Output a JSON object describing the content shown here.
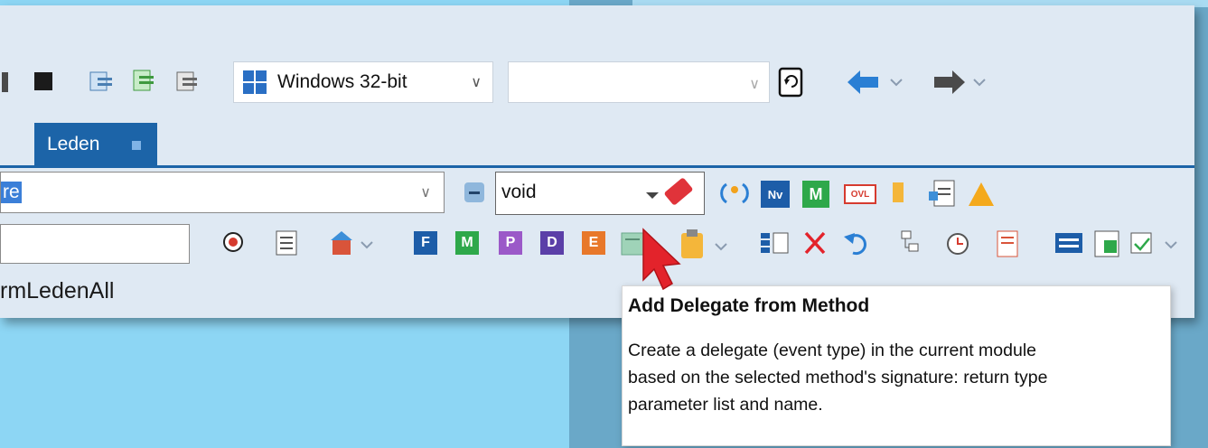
{
  "toolbar": {
    "platform": "Windows 32-bit",
    "second_select": ""
  },
  "tabs": [
    {
      "label": "Leden"
    }
  ],
  "member_bar": {
    "member_selected_text": "re",
    "return_type": "void",
    "badges": {
      "nv": "Nv",
      "m": "M",
      "ovl": "OVL"
    }
  },
  "member_toolbar": {
    "letter_buttons": [
      "F",
      "M",
      "P",
      "D",
      "E"
    ]
  },
  "content": {
    "item_text": "rmLedenAll"
  },
  "tooltip": {
    "title": "Add Delegate from Method",
    "body": "Create a delegate (event type) in the current module\nbased on the selected method's signature: return type\nparameter list and name."
  },
  "colors": {
    "accent": "#1c64a8",
    "tab_bg": "#1c64a8",
    "cursor": "#e3232b"
  }
}
